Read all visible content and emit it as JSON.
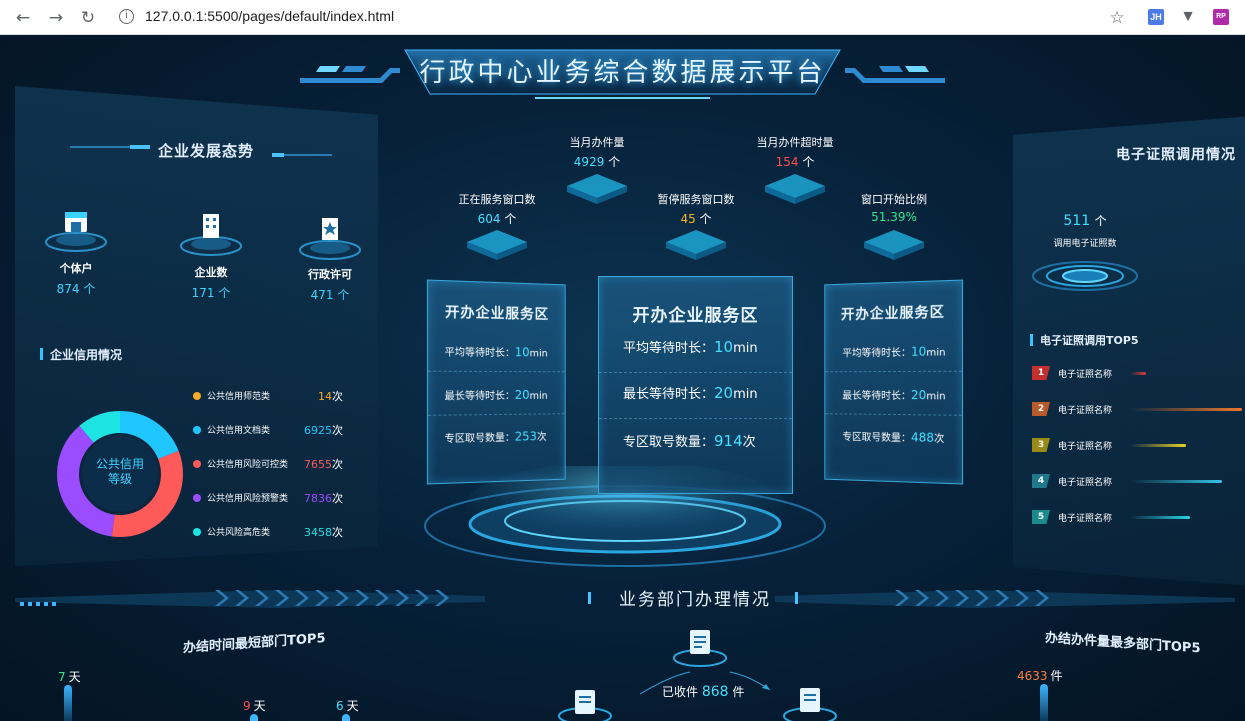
{
  "browser": {
    "url": "127.0.0.1:5500/pages/default/index.html",
    "info_glyph": "i",
    "ext_jh": "JH",
    "ext_rp": "RP"
  },
  "header": {
    "title": "行政中心业务综合数据展示平台"
  },
  "left": {
    "section_title": "企业发展态势",
    "stats": [
      {
        "label": "个体户",
        "value": "874",
        "unit": "个"
      },
      {
        "label": "企业数",
        "value": "171",
        "unit": "个"
      },
      {
        "label": "行政许可",
        "value": "471",
        "unit": "个"
      }
    ],
    "credit_title": "企业信用情况",
    "donut_center": [
      "公共信用",
      "等级"
    ],
    "legend": [
      {
        "label": "公共信用师范类",
        "value": "14",
        "unit": "次",
        "color": "#f7a928"
      },
      {
        "label": "公共信用文档类",
        "value": "6925",
        "unit": "次",
        "color": "#20c6ff"
      },
      {
        "label": "公共信用风险可控类",
        "value": "7655",
        "unit": "次",
        "color": "#ff5a5a"
      },
      {
        "label": "公共信用风险预警类",
        "value": "7836",
        "unit": "次",
        "color": "#9b4cff"
      },
      {
        "label": "公共风险高危类",
        "value": "3458",
        "unit": "次",
        "color": "#1ee3e3"
      }
    ]
  },
  "center": {
    "tiles": [
      {
        "label": "正在服务窗口数",
        "value": "604",
        "unit": "个",
        "color": "#43e0ff"
      },
      {
        "label": "当月办件量",
        "value": "4929",
        "unit": "个",
        "color": "#43e0ff"
      },
      {
        "label": "暂停服务窗口数",
        "value": "45",
        "unit": "个",
        "color": "#f7b52a"
      },
      {
        "label": "当月办件超时量",
        "value": "154",
        "unit": "个",
        "color": "#ff4d4d"
      },
      {
        "label": "窗口开始比例",
        "value": "51.39%",
        "unit": "",
        "color": "#2ee88a"
      }
    ],
    "cards": [
      {
        "title": "开办企业服务区",
        "rows": [
          {
            "label": "平均等待时长：",
            "value": "10",
            "unit": "min"
          },
          {
            "label": "最长等待时长：",
            "value": "20",
            "unit": "min"
          },
          {
            "label": "专区取号数量：",
            "value": "253",
            "unit": "次"
          }
        ]
      },
      {
        "title": "开办企业服务区",
        "rows": [
          {
            "label": "平均等待时长：",
            "value": "10",
            "unit": "min"
          },
          {
            "label": "最长等待时长：",
            "value": "20",
            "unit": "min"
          },
          {
            "label": "专区取号数量：",
            "value": "914",
            "unit": "次"
          }
        ]
      },
      {
        "title": "开办企业服务区",
        "rows": [
          {
            "label": "平均等待时长：",
            "value": "10",
            "unit": "min"
          },
          {
            "label": "最长等待时长：",
            "value": "20",
            "unit": "min"
          },
          {
            "label": "专区取号数量：",
            "value": "488",
            "unit": "次"
          }
        ]
      }
    ]
  },
  "right": {
    "section_title": "电子证照调用情况",
    "call_value": "511",
    "call_unit": "个",
    "call_label": "调用电子证照数",
    "top_title": "电子证照调用TOP5",
    "ranks": [
      {
        "rank": "1",
        "name": "电子证照名称",
        "color": "#e23a3a",
        "fill": 0.15
      },
      {
        "rank": "2",
        "name": "电子证照名称",
        "color": "#f0782a",
        "fill": 1.0
      },
      {
        "rank": "3",
        "name": "电子证照名称",
        "color": "#e6d12a",
        "fill": 0.5
      },
      {
        "rank": "4",
        "name": "电子证照名称",
        "color": "#36c3e6",
        "fill": 0.9
      },
      {
        "rank": "5",
        "name": "电子证照名称",
        "color": "#2ad6e6",
        "fill": 0.65
      }
    ]
  },
  "bottom": {
    "title": "业务部门办理情况",
    "left_title": "办结时间最短部门TOP5",
    "right_title": "办结办件量最多部门TOP5",
    "received_label": "已收件",
    "received_value": "868",
    "received_unit": "件",
    "left_values": [
      {
        "value": "7",
        "unit": "天",
        "color": "#2ee88a"
      },
      {
        "value": "9",
        "unit": "天",
        "color": "#ff4d4d"
      },
      {
        "value": "6",
        "unit": "天",
        "color": "#43e0ff"
      }
    ],
    "right_values": [
      {
        "value": "4633",
        "unit": "件",
        "color": "#ff7a3a"
      }
    ]
  }
}
